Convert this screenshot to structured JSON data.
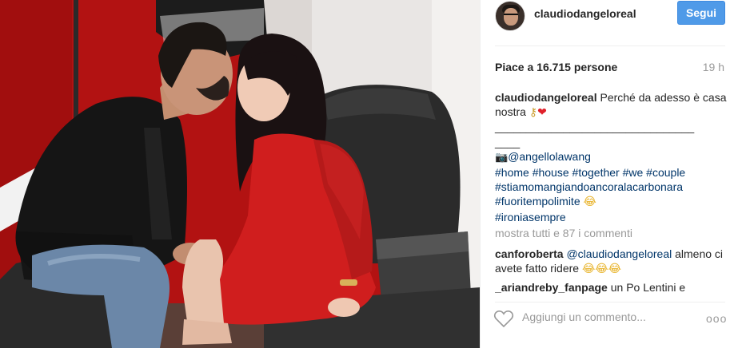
{
  "post": {
    "username": "claudiodangeloreal",
    "follow_label": "Segui",
    "likes_text": "Piace a 16.715 persone",
    "time_ago": "19 h",
    "caption": {
      "username": "claudiodangeloreal",
      "text": "Perché da adesso è casa nostra",
      "rule": "________________________________",
      "rule_cont": "____",
      "credit": "@angellolawang",
      "hashtags": [
        "#home",
        "#house",
        "#together",
        "#we",
        "#couple"
      ],
      "hashtag_line2": "#stiamomangiandoancoralacarbonara",
      "hashtag_line3": "#fuoritempolimite",
      "hashtag_line4": "#ironiasempre"
    },
    "view_all_comments": "mostra tutti e 87 i commenti",
    "comments": [
      {
        "username": "canforoberta",
        "mention": "@claudiodangeloreal",
        "text": "almeno ci avete fatto ridere"
      },
      {
        "username": "_ariandreby_fanpage",
        "text": "un Po Lentini e"
      }
    ],
    "add_comment_placeholder": "Aggiungi un commento...",
    "more_label": "ooo"
  },
  "icons": {
    "like": "heart-outline-icon",
    "more": "more-options-icon",
    "photo_credit": "camera-icon"
  },
  "colors": {
    "follow_button": "#4f9ae8",
    "hashtag": "#003569",
    "muted": "#999999",
    "photo_background": "#b11616"
  }
}
